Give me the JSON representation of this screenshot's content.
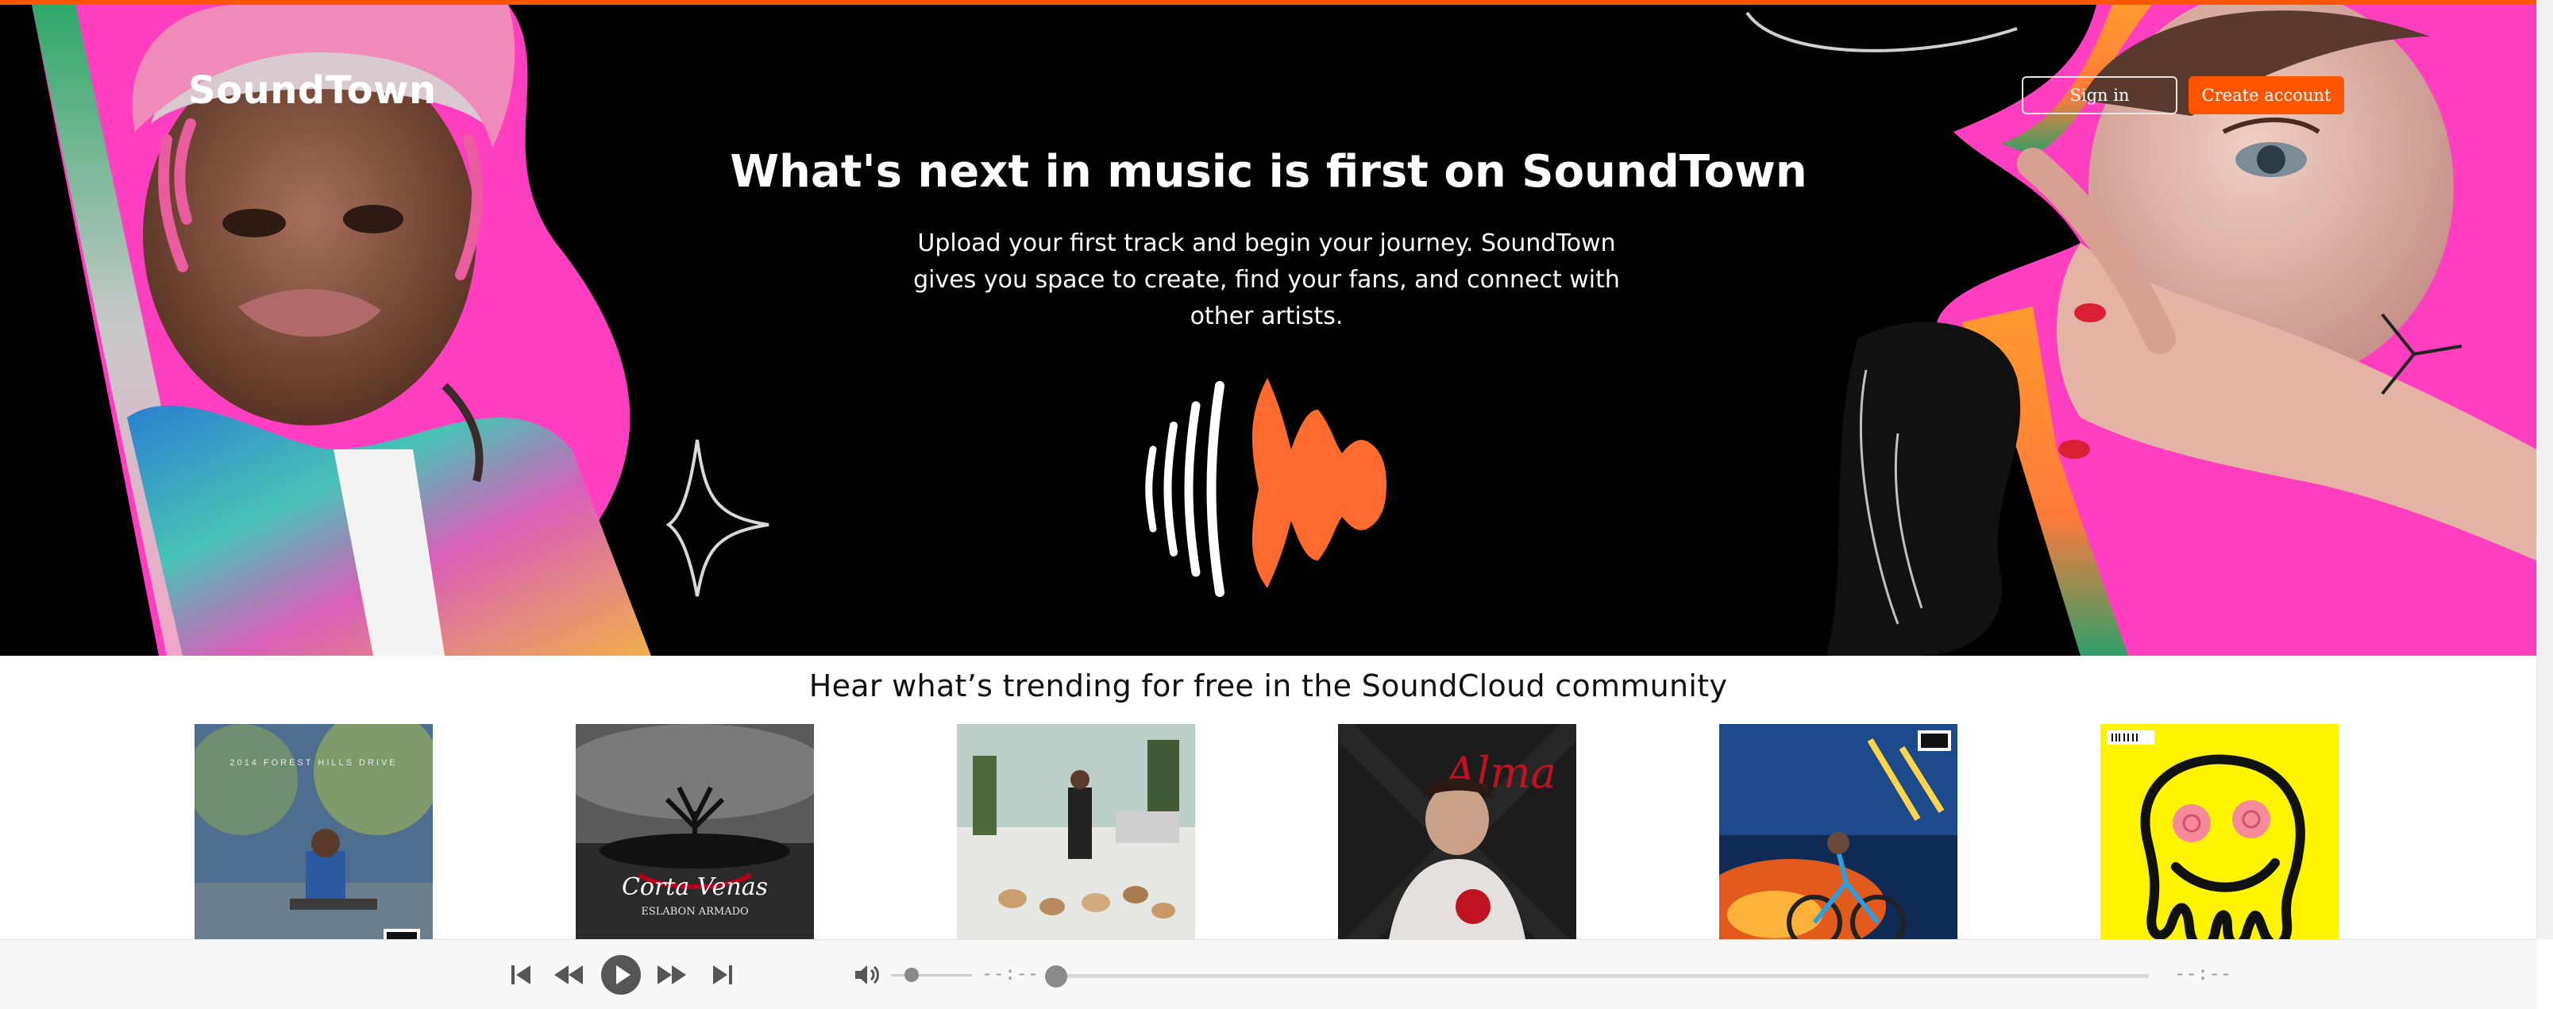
{
  "header": {
    "brand": "SoundTown",
    "signin_label": "Sign in",
    "create_account_label": "Create account"
  },
  "hero": {
    "title": "What's next in music is first on SoundTown",
    "subtitle": "Upload your first track and begin your journey. SoundTown gives you space to create, find your fans, and connect with other artists.",
    "logo_icon": "soundwave-logo-icon"
  },
  "trending": {
    "title": "Hear what’s trending for free in the SoundCloud community",
    "covers": [
      {
        "name": "album-cover-1",
        "text": "2014 FOREST HILLS DRIVE"
      },
      {
        "name": "album-cover-2",
        "text": "Corta Venas",
        "subtext": "ESLABON ARMADO"
      },
      {
        "name": "album-cover-3",
        "text": ""
      },
      {
        "name": "album-cover-4",
        "text": "Alma"
      },
      {
        "name": "album-cover-5",
        "text": ""
      },
      {
        "name": "album-cover-6",
        "text": ""
      }
    ]
  },
  "player": {
    "icons": [
      "skip-previous-icon",
      "rewind-icon",
      "play-icon",
      "fast-forward-icon",
      "skip-next-icon",
      "volume-icon"
    ],
    "current_time": "--:--",
    "total_time": "--:--",
    "volume_level": 0.25,
    "progress": 0
  },
  "colors": {
    "accent": "#ff5500",
    "hero_bg": "#000000",
    "player_bg": "#f8f8f8",
    "magenta": "#ff3fbf"
  }
}
